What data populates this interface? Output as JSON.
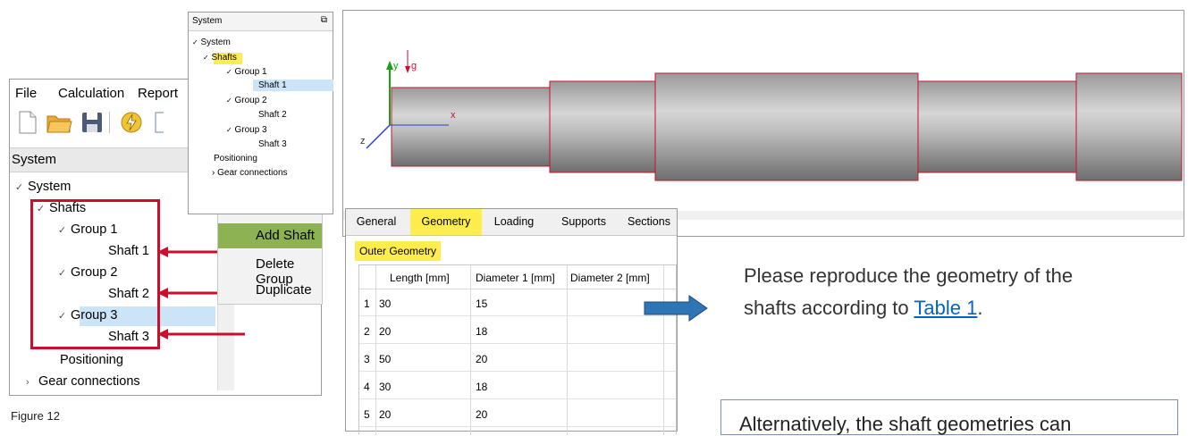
{
  "left_window": {
    "menu": [
      "File",
      "Calculation",
      "Report"
    ],
    "panel_title": "System",
    "tree": {
      "root": "System",
      "shafts": "Shafts",
      "groups": [
        {
          "label": "Group 1",
          "shaft": "Shaft 1"
        },
        {
          "label": "Group 2",
          "shaft": "Shaft 2"
        },
        {
          "label": "Group 3",
          "shaft": "Shaft 3"
        }
      ],
      "positioning": "Positioning",
      "gear_connections": "Gear connections"
    },
    "context_menu": [
      "Add Shaft",
      "Delete Group",
      "Duplicate"
    ]
  },
  "small_window": {
    "title": "System",
    "tree": {
      "root": "System",
      "shafts": "Shafts",
      "groups": [
        {
          "label": "Group 1",
          "shaft": "Shaft 1"
        },
        {
          "label": "Group 2",
          "shaft": "Shaft 2"
        },
        {
          "label": "Group 3",
          "shaft": "Shaft 3"
        }
      ],
      "positioning": "Positioning",
      "gear_connections": "Gear connections"
    }
  },
  "view": {
    "axis_y": "y",
    "axis_g": "g",
    "axis_x": "x",
    "axis_z": "z"
  },
  "geometry_panel": {
    "tabs": [
      "General",
      "Geometry",
      "Loading",
      "Supports",
      "Sections"
    ],
    "active_tab": "Geometry",
    "section_label": "Outer Geometry",
    "columns": [
      "Length [mm]",
      "Diameter 1 [mm]",
      "Diameter 2 [mm]"
    ],
    "rows": [
      {
        "n": "1",
        "length": "30",
        "d1": "15",
        "d2": ""
      },
      {
        "n": "2",
        "length": "20",
        "d1": "18",
        "d2": ""
      },
      {
        "n": "3",
        "length": "50",
        "d1": "20",
        "d2": ""
      },
      {
        "n": "4",
        "length": "30",
        "d1": "18",
        "d2": ""
      },
      {
        "n": "5",
        "length": "20",
        "d1": "20",
        "d2": ""
      }
    ]
  },
  "instruction": {
    "line1": "Please reproduce the geometry of the",
    "line2_prefix": "shafts according to ",
    "link": "Table 1",
    "line2_suffix": "."
  },
  "note": "Alternatively, the shaft geometries can",
  "caption": "Figure 12",
  "colors": {
    "highlight": "#ffec4d",
    "annotation_red": "#c8102e",
    "selection_blue": "#cce4f7",
    "menu_green": "#8db254",
    "arrow_blue": "#2e75b6",
    "link_blue": "#0563c1"
  }
}
